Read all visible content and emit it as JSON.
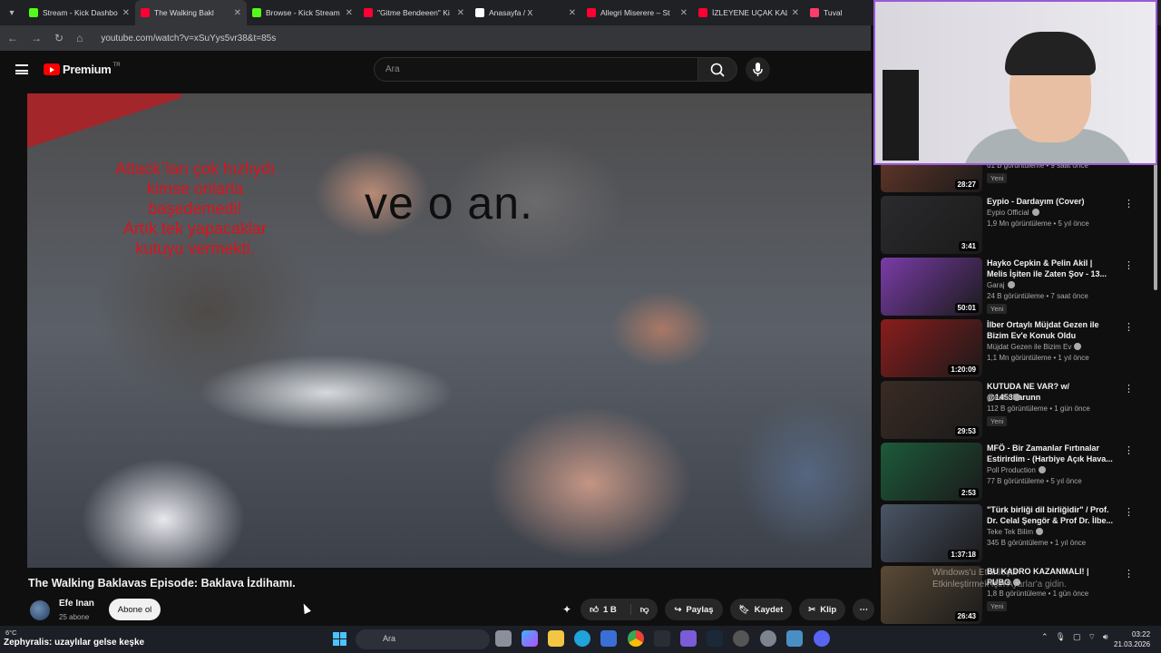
{
  "browser": {
    "tabs": [
      {
        "title": "Stream - Kick Dashbo",
        "favcolor": "#53fc18",
        "active": false
      },
      {
        "title": "The Walking Bakl",
        "favcolor": "#ff0033",
        "active": true
      },
      {
        "title": "Browse - Kick Stream",
        "favcolor": "#53fc18",
        "active": false
      },
      {
        "title": "\"Gitme Bendeeen\" Ki",
        "favcolor": "#ff0033",
        "active": false
      },
      {
        "title": "Anasayfa / X",
        "favcolor": "#ffffff",
        "active": false
      },
      {
        "title": "Allegri Miserere – St",
        "favcolor": "#ff0033",
        "active": false
      },
      {
        "title": "İZLEYENE UÇAK KALI",
        "favcolor": "#ff0033",
        "active": false
      },
      {
        "title": "Tuval",
        "favcolor": "#ff3b6b",
        "active": false
      }
    ],
    "url": "youtube.com/watch?v=xSuYys5vr38&t=85s"
  },
  "youtube": {
    "logo_text": "Premium",
    "region": "TR",
    "search_placeholder": "Ara"
  },
  "video": {
    "overlay_red_lines": [
      "Attack`ları çok hızlıydı",
      "kimse onlarla",
      "başedemedi!",
      "Artık tek yapacaklar",
      "kutuyu vermekti."
    ],
    "overlay_main": "ve o an.",
    "title": "The Walking Baklavas Episode: Baklava İzdihamı.",
    "channel": "Efe Inan",
    "subscribers": "25 abone",
    "subscribe_label": "Abone ol",
    "likes": "1 B",
    "share_label": "Paylaş",
    "save_label": "Kaydet",
    "clip_label": "Klip"
  },
  "sidebar": {
    "items": [
      {
        "title": "",
        "channel": "",
        "meta": "61 B görüntüleme • 9 saat önce",
        "new": "Yeni",
        "duration": "28:27",
        "thumb": "#6c3a2a"
      },
      {
        "title": "Eypio - Dardayım (Cover)",
        "channel": "Eypio Official",
        "meta": "1,9 Mn görüntüleme • 5 yıl önce",
        "new": "",
        "duration": "3:41",
        "thumb": "#2b2b2e"
      },
      {
        "title": "Hayko Cepkin & Pelin Akil | Melis İşiten ile Zaten Şov - 13...",
        "channel": "Garaj",
        "meta": "24 B görüntüleme • 7 saat önce",
        "new": "Yeni",
        "duration": "50:01",
        "thumb": "#7a3ca8"
      },
      {
        "title": "İlber Ortaylı Müjdat Gezen ile Bizim Ev'e Konuk Oldu",
        "channel": "Müjdat Gezen ile Bizim Ev",
        "meta": "1,1 Mn görüntüleme • 1 yıl önce",
        "new": "",
        "duration": "1:20:09",
        "thumb": "#8a1c1c"
      },
      {
        "title": "KUTUDA NE VAR? w/ @1453harunn",
        "channel": "gokalaf",
        "meta": "112 B görüntüleme • 1 gün önce",
        "new": "Yeni",
        "duration": "29:53",
        "thumb": "#3a2b24"
      },
      {
        "title": "MFÖ - Bir Zamanlar Fırtınalar Estirirdim - (Harbiye Açık Hava...",
        "channel": "Poll Production",
        "meta": "77 B görüntüleme • 5 yıl önce",
        "new": "",
        "duration": "2:53",
        "thumb": "#1d5a3a"
      },
      {
        "title": "\"Türk birliği dil birliğidir\" / Prof. Dr. Celal Şengör & Prof Dr. İlbe...",
        "channel": "Teke Tek Bilim",
        "meta": "345 B görüntüleme • 1 yıl önce",
        "new": "",
        "duration": "1:37:18",
        "thumb": "#4a5566"
      },
      {
        "title": "BU KADRO KAZANMALI! | PUBG",
        "channel": "Nurlam",
        "meta": "1,8 B görüntüleme • 1 gün önce",
        "new": "Yeni",
        "duration": "26:43",
        "thumb": "#5a4a36"
      }
    ]
  },
  "os": {
    "windows_watermark_1": "Windows'u Etkinleştir",
    "windows_watermark_2": "Etkinleştirmek için Ayarlar'a gidin.",
    "weather_temp": "6°C",
    "ticker_name": "Zephyralis",
    "ticker_msg": ": uzaylılar gelse keşke",
    "taskbar_search": "Ara",
    "time": "03:22",
    "date": "21.03.2026"
  }
}
